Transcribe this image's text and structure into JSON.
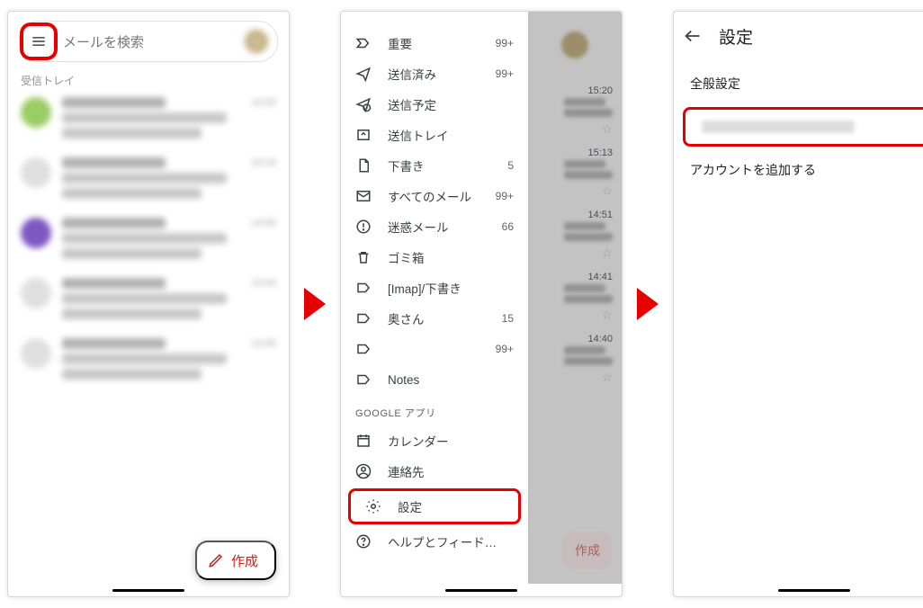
{
  "compose_label": "作成",
  "panel1": {
    "search_placeholder": "メールを検索",
    "section": "受信トレイ",
    "items": [
      {
        "color": "#9ccc65",
        "time": "14:20"
      },
      {
        "color": "#e0e0e0",
        "time": "10:19"
      },
      {
        "color": "#7e57c2",
        "time": "14:00"
      },
      {
        "color": "#e0e0e0",
        "time": "14:44"
      },
      {
        "color": "#e0e0e0",
        "time": "14:40"
      }
    ]
  },
  "panel2": {
    "items": [
      {
        "icon": "important",
        "label": "重要",
        "badge": "99+"
      },
      {
        "icon": "sent",
        "label": "送信済み",
        "badge": "99+"
      },
      {
        "icon": "scheduled",
        "label": "送信予定",
        "badge": ""
      },
      {
        "icon": "outbox",
        "label": "送信トレイ",
        "badge": ""
      },
      {
        "icon": "draft",
        "label": "下書き",
        "badge": "5"
      },
      {
        "icon": "all",
        "label": "すべてのメール",
        "badge": "99+"
      },
      {
        "icon": "spam",
        "label": "迷惑メール",
        "badge": "66"
      },
      {
        "icon": "trash",
        "label": "ゴミ箱",
        "badge": ""
      },
      {
        "icon": "label",
        "label": "[Imap]/下書き",
        "badge": ""
      },
      {
        "icon": "label",
        "label": "奥さん",
        "badge": "15"
      },
      {
        "icon": "label",
        "label": "",
        "badge": "99+",
        "blurred": true
      },
      {
        "icon": "label",
        "label": "Notes",
        "badge": ""
      }
    ],
    "section_header": "GOOGLE アプリ",
    "apps": [
      {
        "icon": "calendar",
        "label": "カレンダー"
      },
      {
        "icon": "contacts",
        "label": "連絡先"
      }
    ],
    "footer": [
      {
        "icon": "settings",
        "label": "設定",
        "highlight": true
      },
      {
        "icon": "help",
        "label": "ヘルプとフィードバック"
      }
    ],
    "behind": [
      {
        "time": "15:20",
        "l1": "で1件...",
        "l2": "ット..."
      },
      {
        "time": "15:13",
        "l1": "で51...",
        "l2": "リス..."
      },
      {
        "time": "14:51",
        "l1": "i",
        "l2": "4 with..."
      },
      {
        "time": "14:41",
        "l1": "λがR...",
        "l2": "λがR..."
      },
      {
        "time": "14:40",
        "l1": "いて",
        "l2": "上場..."
      }
    ]
  },
  "panel3": {
    "title": "設定",
    "general": "全般設定",
    "add_account": "アカウントを追加する"
  }
}
